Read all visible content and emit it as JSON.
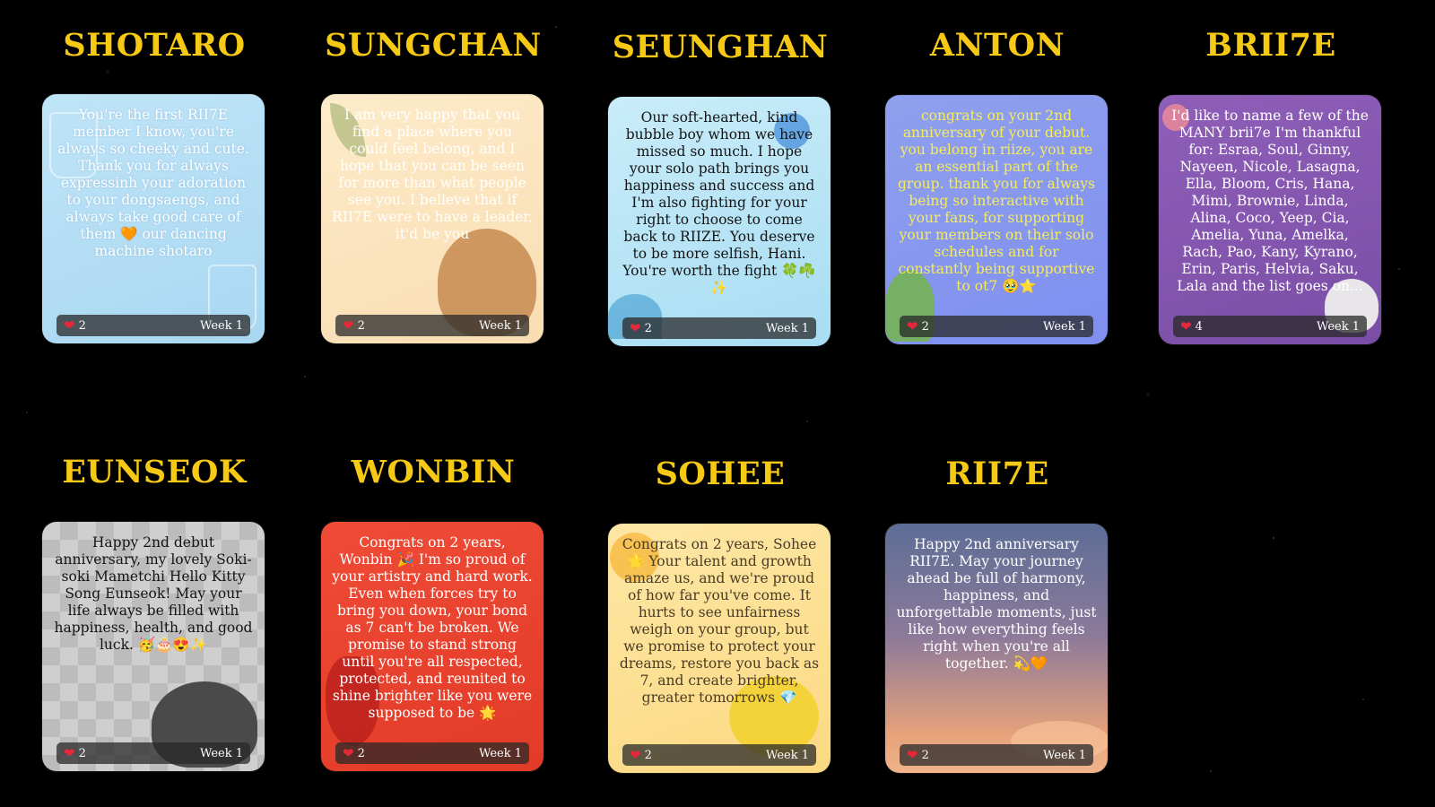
{
  "cards": [
    {
      "name": "SHOTARO",
      "message": "You're the first RII7E member I know, you're always so cheeky and cute. Thank you for always expressinh your adoration to your dongsaengs, and always take good care of them 🧡 our dancing machine shotaro",
      "likes": "2",
      "week": "Week 1"
    },
    {
      "name": "SUNGCHAN",
      "message": "I am very happy that you find a place where you could feel belong, and I hope that you can be seen for more than what people see you. I believe that if RII7E were to have a leader, it'd be you",
      "likes": "2",
      "week": "Week 1"
    },
    {
      "name": "SEUNGHAN",
      "message": "Our soft-hearted, kind bubble boy whom we have missed so much. I hope your solo path brings you happiness and success and I'm also fighting for your right to choose to come back to RIIZE. You deserve to be more selfish, Hani. You're worth the fight 🍀☘️✨",
      "likes": "2",
      "week": "Week 1"
    },
    {
      "name": "ANTON",
      "message": "congrats on your 2nd anniversary of your debut. you belong in riize, you are an essential part of the group. thank you for always being so interactive with your fans, for supporting your members on their solo schedules and for constantly being supportive to ot7 🥹⭐",
      "likes": "2",
      "week": "Week 1"
    },
    {
      "name": "BRII7E",
      "message": "I'd like to name a few of the MANY brii7e I'm thankful for: Esraa, Soul, Ginny, Nayeen, Nicole, Lasagna, Ella, Bloom, Cris, Hana, Mimi, Brownie, Linda, Alina, Coco, Yeep, Cia, Amelia, Yuna, Amelka, Rach, Pao, Kany, Kyrano, Erin, Paris, Helvia, Saku, Lala and the list goes on...",
      "likes": "4",
      "week": "Week 1"
    },
    {
      "name": "EUNSEOK",
      "message": "Happy 2nd debut anniversary, my lovely Soki-soki Mametchi Hello Kitty Song Eunseok! May your life always be filled with happiness, health, and good luck. 🥳🎂😍✨",
      "likes": "2",
      "week": "Week 1"
    },
    {
      "name": "WONBIN",
      "message": "Congrats on 2 years, Wonbin 🎉 I'm so proud of your artistry and hard work. Even when forces try to bring you down, your bond as 7 can't be broken. We promise to stand strong until you're all respected, protected, and reunited to shine brighter like you were supposed to be 🌟",
      "likes": "2",
      "week": "Week 1"
    },
    {
      "name": "SOHEE",
      "message": "Congrats on 2 years, Sohee 🌟 Your talent and growth amaze us, and we're proud of how far you've come. It hurts to see unfairness weigh on your group, but we promise to protect your dreams, restore you back as 7, and create brighter, greater tomorrows 💎",
      "likes": "2",
      "week": "Week 1"
    },
    {
      "name": "RII7E",
      "message": "Happy 2nd anniversary RII7E. May your journey ahead be full of harmony, happiness, and unforgettable moments, just like how everything feels right when you're all together. 💫🧡",
      "likes": "2",
      "week": "Week 1"
    }
  ],
  "icons": {
    "like": "heart-icon"
  },
  "colors": {
    "name": "#f6c915",
    "background": "#000000",
    "heart": "#e8283a"
  }
}
